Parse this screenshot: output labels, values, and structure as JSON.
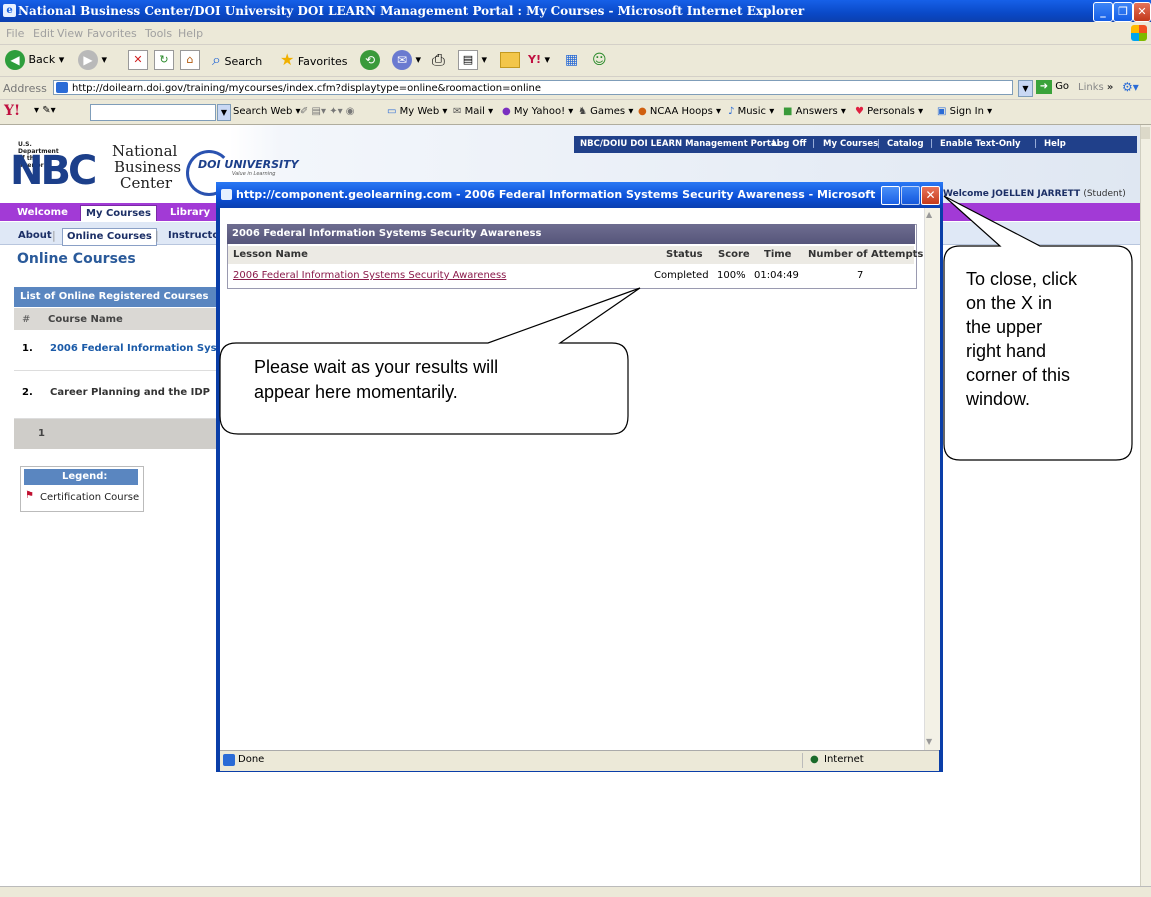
{
  "browser": {
    "title": "National Business Center/DOI University DOI LEARN Management Portal : My Courses - Microsoft Internet Explorer",
    "menu": [
      "File",
      "Edit",
      "View",
      "Favorites",
      "Tools",
      "Help"
    ],
    "toolbar": {
      "back": "Back",
      "search": "Search",
      "favorites": "Favorites"
    },
    "address_label": "Address",
    "address_url": "http://doilearn.doi.gov/training/mycourses/index.cfm?displaytype=online&roomaction=online",
    "go_label": "Go",
    "links_label": "Links",
    "yahoo": {
      "search_web": "Search Web",
      "my_web": "My Web",
      "mail": "Mail",
      "my_yahoo": "My Yahoo!",
      "games": "Games",
      "ncaa": "NCAA Hoops",
      "music": "Music",
      "answers": "Answers",
      "personals": "Personals",
      "sign_in": "Sign In"
    }
  },
  "site": {
    "logo_caption": "U.S. Department of the Interior",
    "logo_letters": "NBC",
    "logo_name": [
      "National",
      "Business",
      "Center"
    ],
    "doi_university": "DOI UNIVERSITY",
    "doi_tagline": "Value in Learning",
    "top_nav": [
      "NBC/DOIU DOI LEARN Management Portal",
      "Log Off",
      "My Courses",
      "Catalog",
      "Enable Text-Only",
      "Help"
    ],
    "welcome_text": "Welcome JOELLEN JARRETT",
    "welcome_role": "(Student)",
    "nav_tabs": [
      "Welcome",
      "My Courses",
      "Library"
    ],
    "sub_tabs": [
      "About",
      "Online Courses",
      "Instructor"
    ],
    "section_title": "Online Courses",
    "list_header": "List of Online Registered Courses",
    "col_num": "#",
    "col_course": "Course Name",
    "courses": [
      {
        "num": "1.",
        "name": "2006 Federal Information Systen"
      },
      {
        "num": "2.",
        "name": "Career Planning and the IDP"
      }
    ],
    "page_num": "1",
    "legend_title": "Legend:",
    "legend_item": "Certification Course"
  },
  "popup": {
    "title": "http://component.geolearning.com - 2006 Federal Information Systems Security Awareness - Microsoft Internet ...",
    "table_title": "2006 Federal Information Systems Security Awareness",
    "columns": {
      "lesson": "Lesson Name",
      "status": "Status",
      "score": "Score",
      "time": "Time",
      "attempts": "Number of Attempts"
    },
    "row": {
      "lesson": "2006 Federal Information Systems Security Awareness",
      "status": "Completed",
      "score": "100%",
      "time": "01:04:49",
      "attempts": "7"
    },
    "status_done": "Done",
    "status_zone": "Internet"
  },
  "callouts": {
    "wait": [
      "Please wait as your results will",
      "appear here momentarily."
    ],
    "close": [
      "To close, click",
      "on the X in",
      "the upper",
      "right hand",
      "corner of this",
      "window."
    ]
  }
}
